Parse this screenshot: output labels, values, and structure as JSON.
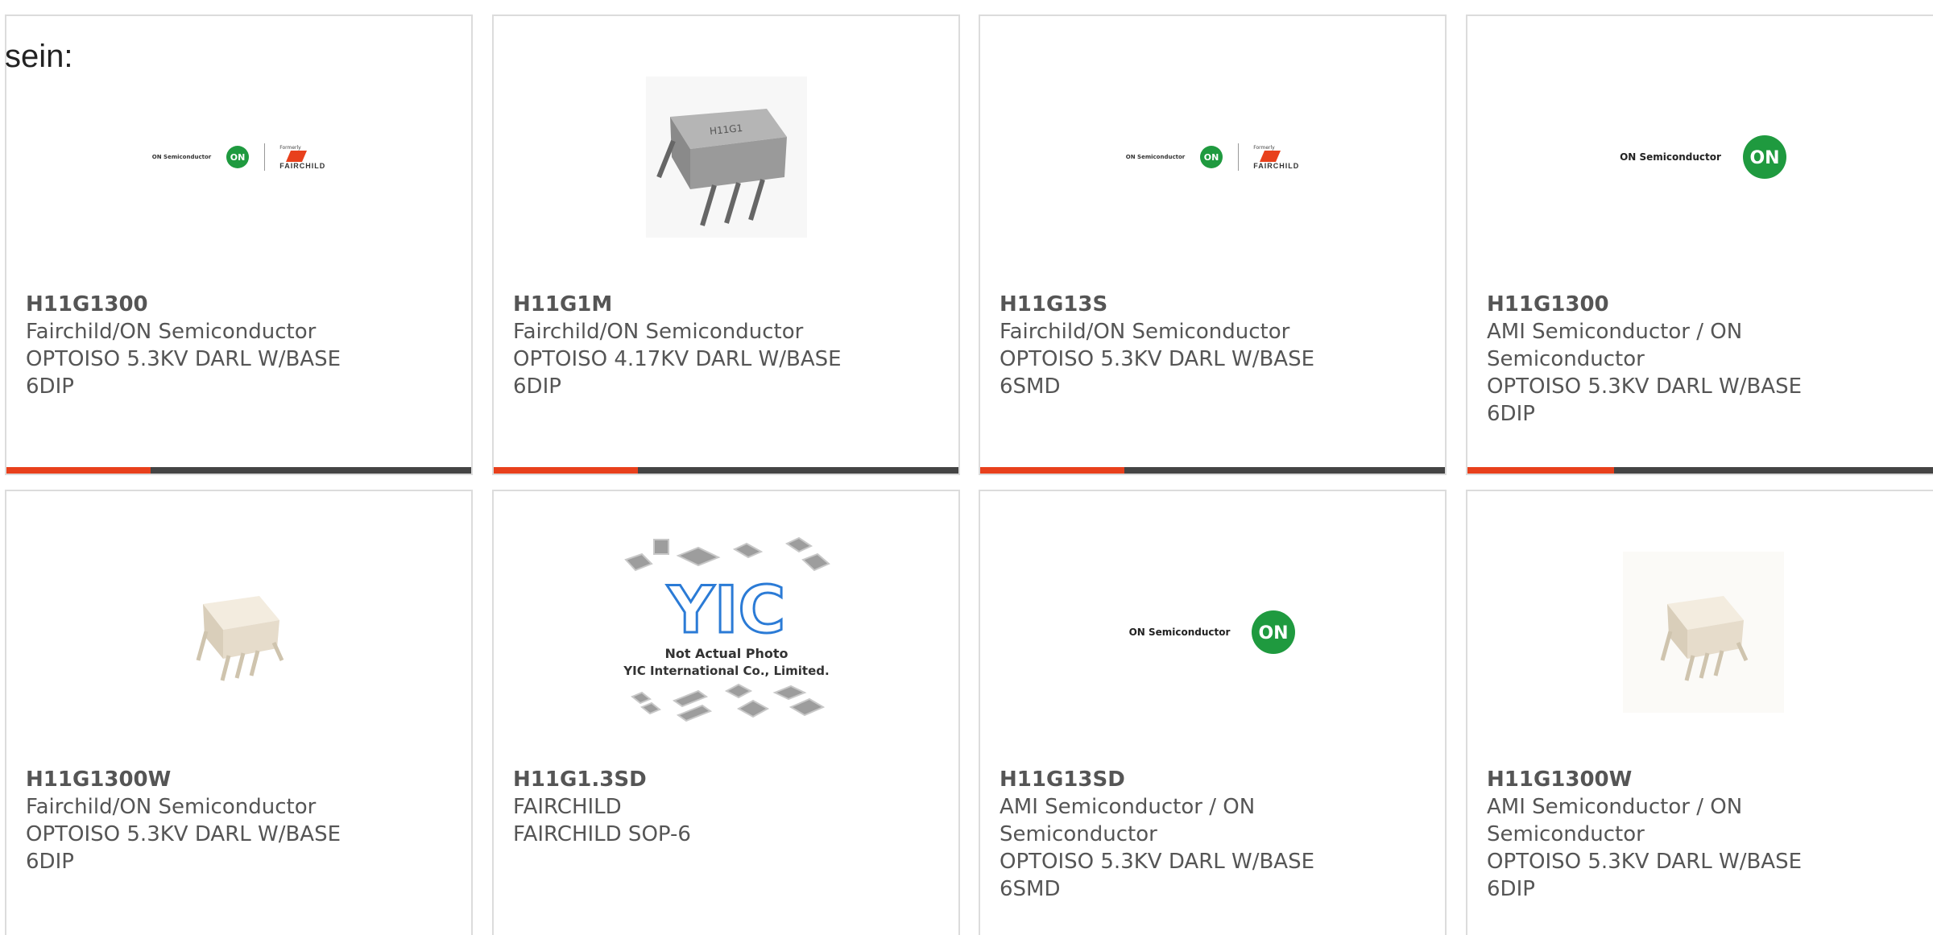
{
  "page": {
    "intro_text": "sein:"
  },
  "colors": {
    "accent": "#e8401c",
    "track": "#444444",
    "on_green": "#1f9a3f",
    "fairchild_red": "#e8401c"
  },
  "logos": {
    "on_semiconductor": "ON Semiconductor",
    "on_mark": "ON",
    "formerly": "Formerly",
    "fairchild": "FAIRCHILD"
  },
  "products": [
    {
      "part_number": "H11G1300",
      "lines": [
        "Fairchild/ON Semiconductor",
        "OPTOISO 5.3KV DARL W/BASE",
        "6DIP"
      ],
      "image": "on-fairchild-logo",
      "progress": 0.31
    },
    {
      "part_number": "H11G1M",
      "lines": [
        "Fairchild/ON Semiconductor",
        "OPTOISO 4.17KV DARL W/BASE",
        "6DIP"
      ],
      "image": "grey-dip-chip-photo",
      "chip_marking": "H11G1",
      "progress": 0.31
    },
    {
      "part_number": "H11G13S",
      "lines": [
        "Fairchild/ON Semiconductor",
        "OPTOISO 5.3KV DARL W/BASE",
        "6SMD"
      ],
      "image": "on-fairchild-logo",
      "progress": 0.31
    },
    {
      "part_number": "H11G1300",
      "lines": [
        "AMI Semiconductor / ON",
        "Semiconductor",
        "OPTOISO 5.3KV DARL W/BASE",
        "6DIP"
      ],
      "image": "on-semiconductor-logo",
      "progress": 0.31
    },
    {
      "part_number": "H11G1300W",
      "lines": [
        "Fairchild/ON Semiconductor",
        "OPTOISO 5.3KV DARL W/BASE",
        "6DIP"
      ],
      "image": "white-dip-chip-photo"
    },
    {
      "part_number": "H11G1.3SD",
      "lines": [
        "FAIRCHILD",
        "FAIRCHILD SOP-6"
      ],
      "image": "yic-placeholder",
      "placeholder_logo": "YIC",
      "placeholder_line1": "Not Actual Photo",
      "placeholder_line2": "YIC International Co., Limited."
    },
    {
      "part_number": "H11G13SD",
      "lines": [
        "AMI Semiconductor / ON",
        "Semiconductor",
        "OPTOISO 5.3KV DARL W/BASE",
        "6SMD"
      ],
      "image": "on-semiconductor-logo"
    },
    {
      "part_number": "H11G1300W",
      "lines": [
        "AMI Semiconductor / ON",
        "Semiconductor",
        "OPTOISO 5.3KV DARL W/BASE",
        "6DIP"
      ],
      "image": "white-dip-chip-photo"
    }
  ]
}
